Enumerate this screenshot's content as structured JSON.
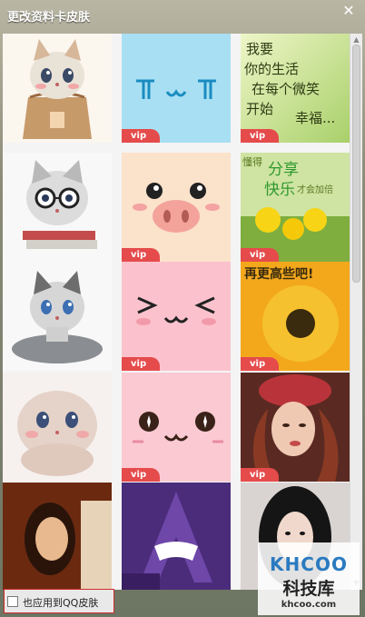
{
  "window": {
    "title": "更改资料卡皮肤",
    "close_glyph": "✕"
  },
  "skins": [
    {
      "vip": ""
    },
    {
      "vip": "vip",
      "text": "ㄒㄩㄒ"
    },
    {
      "vip": "vip",
      "text": "我要 你的生活 在每个微笑 开始 幸福..."
    },
    {
      "vip": ""
    },
    {
      "vip": "vip"
    },
    {
      "vip": "vip",
      "text": "懂得 分享 快乐才会加倍"
    },
    {
      "vip": ""
    },
    {
      "vip": "vip"
    },
    {
      "vip": "vip",
      "text": "再更高些吧!"
    },
    {
      "vip": ""
    },
    {
      "vip": "vip"
    },
    {
      "vip": "vip"
    },
    {
      "vip": ""
    },
    {
      "vip": ""
    },
    {
      "vip": ""
    }
  ],
  "footer": {
    "apply_to_qq_label": "也应用到QQ皮肤",
    "apply_checked": false
  },
  "watermark": {
    "logo": "KHCOO",
    "cn": "科技库",
    "url": "khcoo.com"
  },
  "colors": {
    "selected_outline": "#d12b2b",
    "vip_badge": "#e54b4b"
  }
}
